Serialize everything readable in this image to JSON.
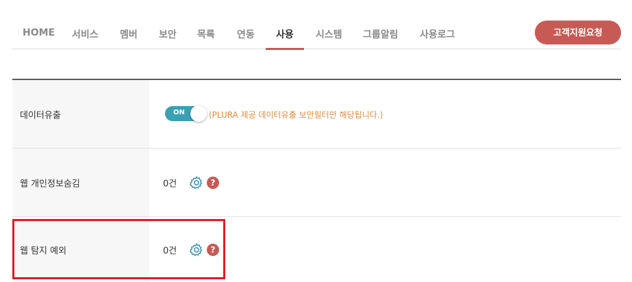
{
  "nav": {
    "tabs": [
      {
        "label": "HOME"
      },
      {
        "label": "서비스"
      },
      {
        "label": "멤버"
      },
      {
        "label": "보안"
      },
      {
        "label": "목록"
      },
      {
        "label": "연동"
      },
      {
        "label": "사용"
      },
      {
        "label": "시스템"
      },
      {
        "label": "그룹알림"
      },
      {
        "label": "사용로그"
      }
    ],
    "active_tab": "사용"
  },
  "support_button": {
    "label": "고객지원요청"
  },
  "rows": [
    {
      "label": "데이터유출",
      "toggle": {
        "state": "ON",
        "on": true
      },
      "note": "(PLURA 제공 데이터유출 보안필터만 해당됩니다.)"
    },
    {
      "label": "웹 개인정보숨김",
      "count": "0건"
    },
    {
      "label": "웹 탐지 예외",
      "count": "0건"
    }
  ],
  "colors": {
    "accent": "#c85a55",
    "toggle": "#3aa0b4",
    "note": "#e08a3c",
    "highlight": "#e11b22"
  },
  "icons": {
    "settings": "gear-icon",
    "help": "question-circle-icon"
  }
}
